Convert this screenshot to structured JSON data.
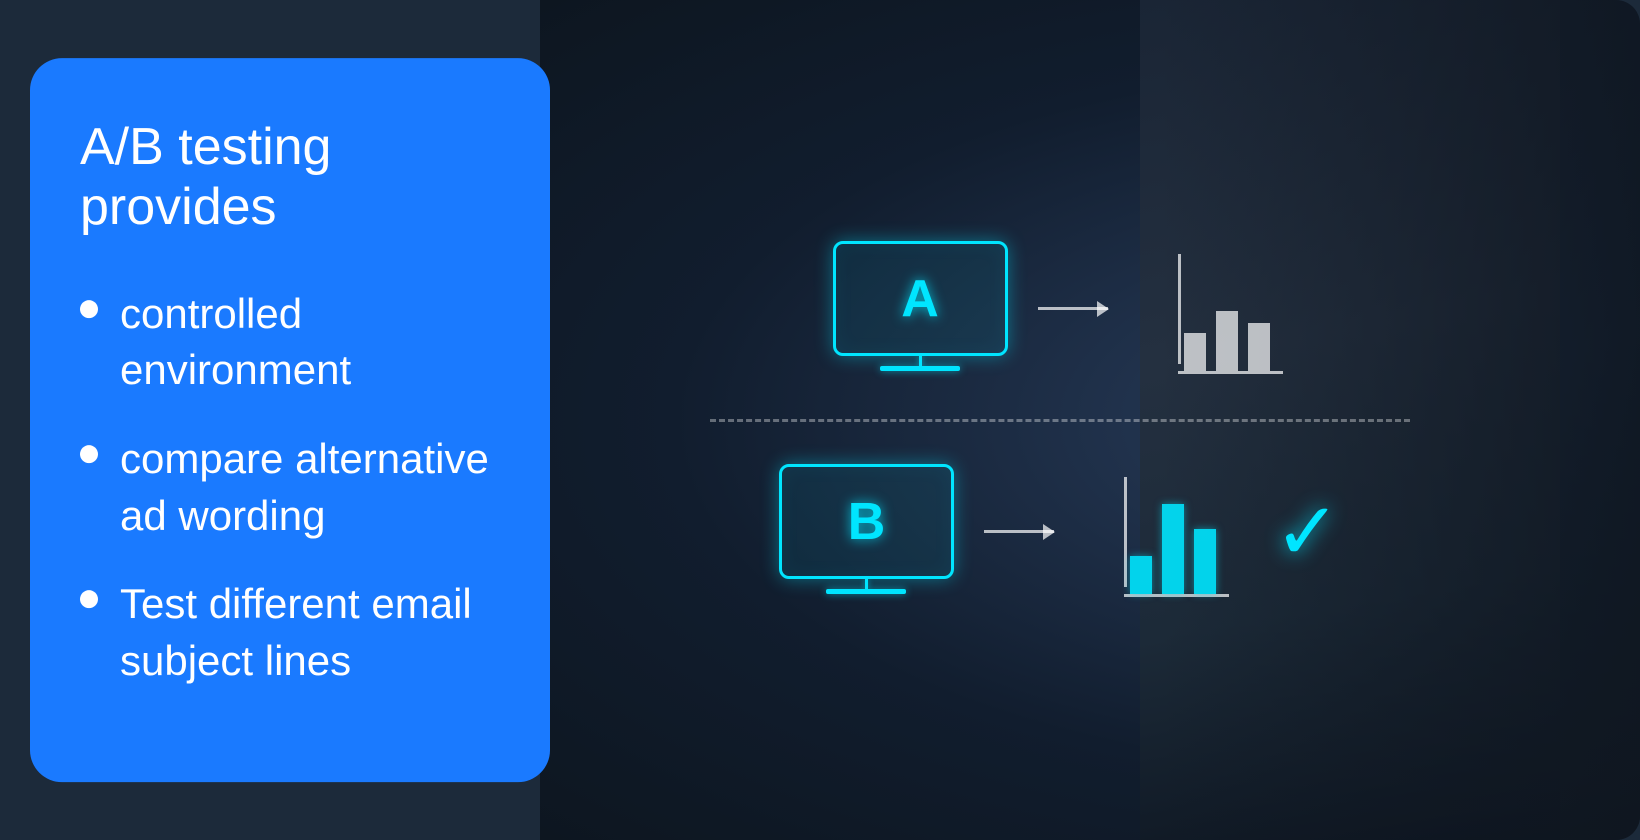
{
  "card": {
    "heading": "A/B testing provides",
    "bullets": [
      {
        "id": "bullet-1",
        "text": "controlled environment"
      },
      {
        "id": "bullet-2",
        "text": "compare alternative ad wording"
      },
      {
        "id": "bullet-3",
        "text": "Test different email subject lines"
      }
    ]
  },
  "diagram": {
    "variant_a_label": "A",
    "variant_b_label": "B",
    "checkmark": "✓"
  },
  "colors": {
    "card_bg": "#1a7aff",
    "text": "#ffffff",
    "cyan_accent": "#00e5ff"
  }
}
